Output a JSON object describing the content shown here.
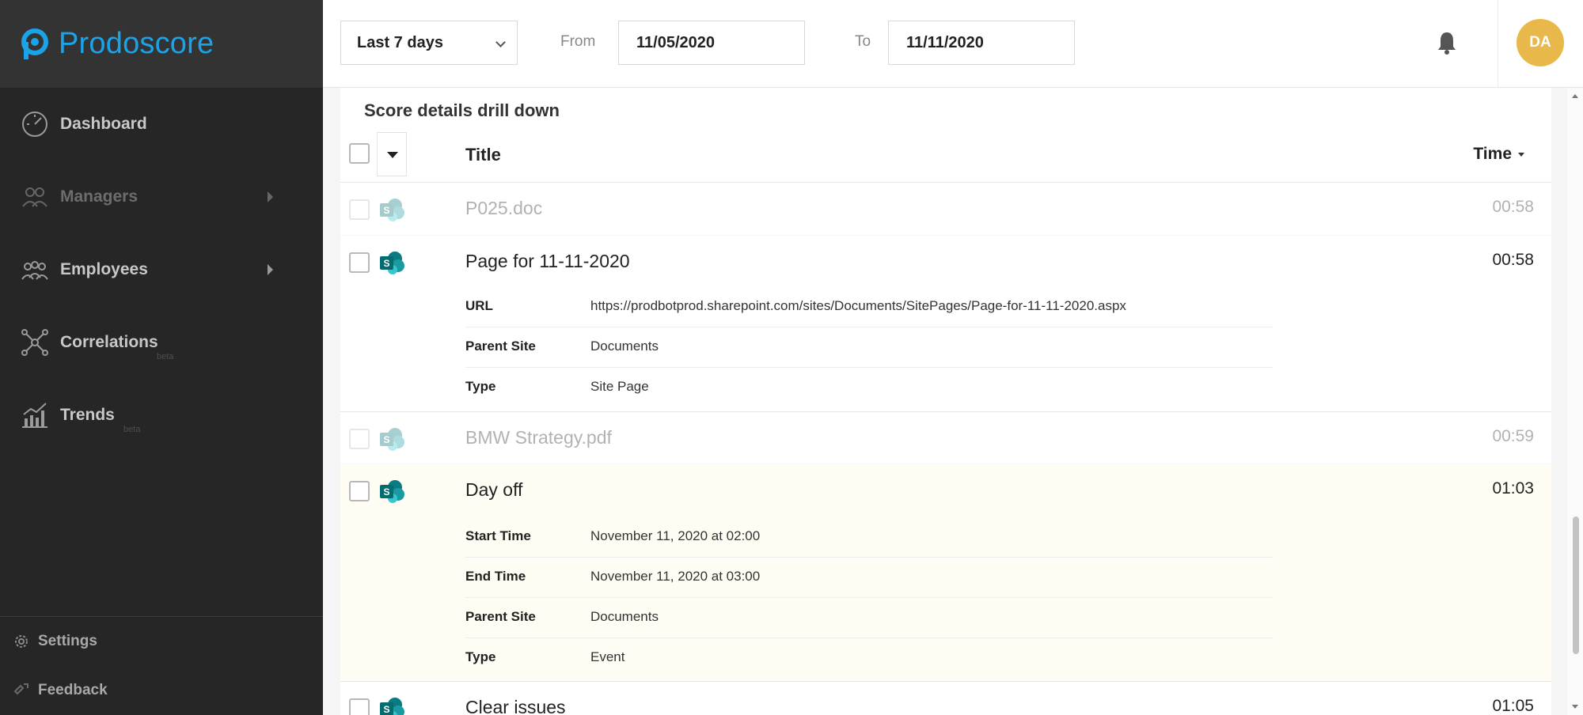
{
  "brand": {
    "name": "Prodoscore",
    "color": "#1aa3e8"
  },
  "sidebar": {
    "items": [
      {
        "label": "Dashboard",
        "icon": "gauge-icon",
        "dim": false,
        "caret": false,
        "beta": ""
      },
      {
        "label": "Managers",
        "icon": "managers-icon",
        "dim": true,
        "caret": true,
        "beta": ""
      },
      {
        "label": "Employees",
        "icon": "employees-icon",
        "dim": false,
        "caret": true,
        "beta": ""
      },
      {
        "label": "Correlations",
        "icon": "correlations-icon",
        "dim": false,
        "caret": false,
        "beta": "beta"
      },
      {
        "label": "Trends",
        "icon": "trends-icon",
        "dim": false,
        "caret": false,
        "beta": "beta"
      }
    ],
    "settings_label": "Settings",
    "feedback_label": "Feedback"
  },
  "topbar": {
    "range_select": "Last 7 days",
    "from_label": "From",
    "from_value": "11/05/2020",
    "to_label": "To",
    "to_value": "11/11/2020",
    "avatar_initials": "DA",
    "avatar_color": "#e8b84a"
  },
  "panel": {
    "title": "Score details drill down",
    "col_title": "Title",
    "col_time": "Time"
  },
  "rows": [
    {
      "title": "P025.doc",
      "time": "00:58",
      "faded": true,
      "details": []
    },
    {
      "title": "Page for 11-11-2020",
      "time": "00:58",
      "faded": false,
      "details": [
        {
          "key": "URL",
          "value": "https://prodbotprod.sharepoint.com/sites/Documents/SitePages/Page-for-11-11-2020.aspx"
        },
        {
          "key": "Parent Site",
          "value": "Documents"
        },
        {
          "key": "Type",
          "value": "Site Page"
        }
      ]
    },
    {
      "title": "BMW Strategy.pdf",
      "time": "00:59",
      "faded": true,
      "details": []
    },
    {
      "title": "Day off",
      "time": "01:03",
      "faded": false,
      "details": [
        {
          "key": "Start Time",
          "value": "November 11, 2020 at 02:00"
        },
        {
          "key": "End Time",
          "value": "November 11, 2020 at 03:00"
        },
        {
          "key": "Parent Site",
          "value": "Documents"
        },
        {
          "key": "Type",
          "value": "Event"
        }
      ]
    },
    {
      "title": "Clear issues",
      "time": "01:05",
      "faded": false,
      "details": []
    }
  ]
}
